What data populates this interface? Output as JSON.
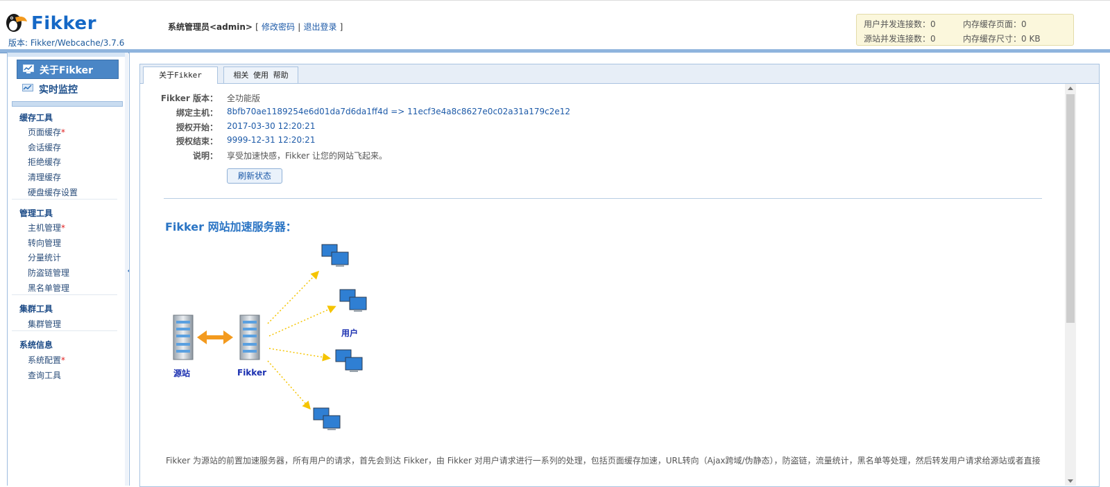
{
  "header": {
    "logo_text": "Fikker",
    "version": "版本: Fikker/Webcache/3.7.6",
    "admin_prefix": "系统管理员<admin>",
    "bracket_open": "[",
    "change_password": "修改密码",
    "separator": "|",
    "logout": "退出登录",
    "bracket_close": "]",
    "stats": {
      "user_connections": "用户并发连接数：0",
      "memory_pages": "内存缓存页面：0",
      "origin_connections": "源站并发连接数：0",
      "memory_size": "内存缓存尺寸：0 KB"
    }
  },
  "sidebar": {
    "about": "关于Fikker",
    "monitor": "实时监控",
    "groups": [
      {
        "title": "缓存工具",
        "items": [
          {
            "label": "页面缓存",
            "required": "*"
          },
          {
            "label": "会话缓存",
            "required": ""
          },
          {
            "label": "拒绝缓存",
            "required": ""
          },
          {
            "label": "清理缓存",
            "required": ""
          },
          {
            "label": "硬盘缓存设置",
            "required": ""
          }
        ]
      },
      {
        "title": "管理工具",
        "items": [
          {
            "label": "主机管理",
            "required": "*"
          },
          {
            "label": "转向管理",
            "required": ""
          },
          {
            "label": "分量统计",
            "required": ""
          },
          {
            "label": "防盗链管理",
            "required": ""
          },
          {
            "label": "黑名单管理",
            "required": ""
          }
        ]
      },
      {
        "title": "集群工具",
        "items": [
          {
            "label": "集群管理",
            "required": ""
          }
        ]
      },
      {
        "title": "系统信息",
        "items": [
          {
            "label": "系统配置",
            "required": "*"
          },
          {
            "label": "查询工具",
            "required": ""
          }
        ]
      }
    ]
  },
  "tabs": {
    "about": "关于Fikker",
    "help": "相关 使用 帮助"
  },
  "info": {
    "edition_label": "Fikker 版本：",
    "edition_value": "全功能版",
    "host_label": "绑定主机：",
    "host_value": "8bfb70ae1189254e6d01da7d6da1ff4d => 11ecf3e4a8c8627e0c02a31a179c2e12",
    "start_label": "授权开始：",
    "start_value": "2017-03-30 12:20:21",
    "end_label": "授权结束：",
    "end_value": "9999-12-31 12:20:21",
    "desc_label": "说明：",
    "desc_value": "享受加速快感，Fikker 让您的网站飞起来。",
    "refresh_button": "刷新状态"
  },
  "section_title": "Fikker 网站加速服务器：",
  "diagram": {
    "origin_label": "源站",
    "fikker_label": "Fikker",
    "users_label": "用户",
    "accent_color": "#f39a1e",
    "arrow_color": "#f5c400"
  },
  "footer_text": "Fikker 为源站的前置加速服务器，所有用户的请求，首先会到达 Fikker，由 Fikker 对用户请求进行一系列的处理，包括页面缓存加速，URL转向（Ajax跨域/伪静态），防盗链，流量统计，黑名单等处理，然后转发用户请求给源站或者直接"
}
